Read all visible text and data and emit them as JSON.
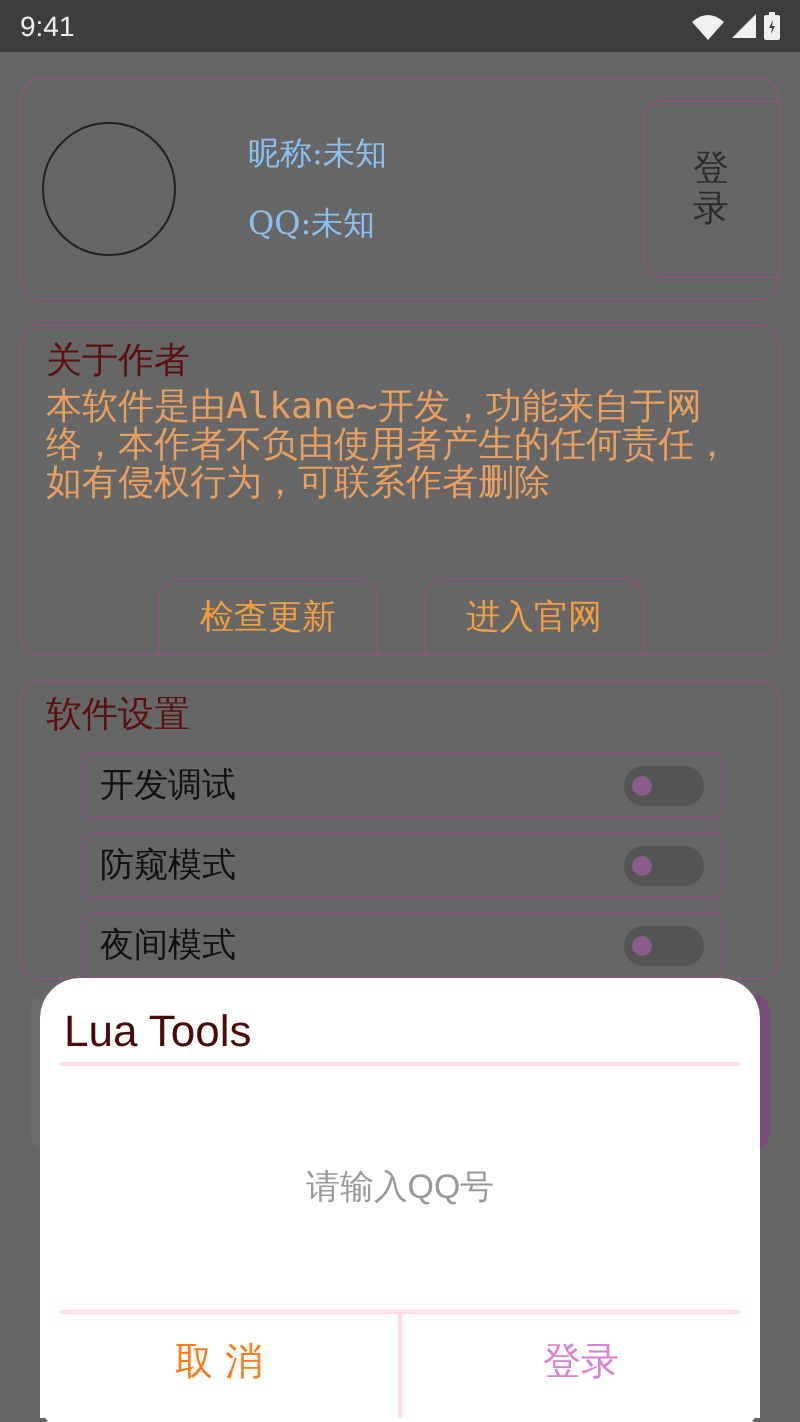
{
  "status_bar": {
    "time": "9:41"
  },
  "profile": {
    "nickname": "昵称:未知",
    "qq": "QQ:未知",
    "login_button": "登录"
  },
  "about": {
    "title": "关于作者",
    "text": "本软件是由Alkane~开发，功能来自于网络，本作者不负由使用者产生的任何责任，如有侵权行为，可联系作者删除",
    "buttons": [
      "检查更新",
      "进入官网"
    ]
  },
  "settings": {
    "title": "软件设置",
    "items": [
      {
        "label": "开发调试",
        "on": false
      },
      {
        "label": "防窥模式",
        "on": false
      },
      {
        "label": "夜间模式",
        "on": false
      }
    ]
  },
  "dialog": {
    "title": "Lua Tools",
    "input": {
      "placeholder": "请输入QQ号"
    },
    "buttons": [
      {
        "label": "取 消",
        "kind": "cancel"
      },
      {
        "label": "登录",
        "kind": "confirm"
      }
    ]
  }
}
